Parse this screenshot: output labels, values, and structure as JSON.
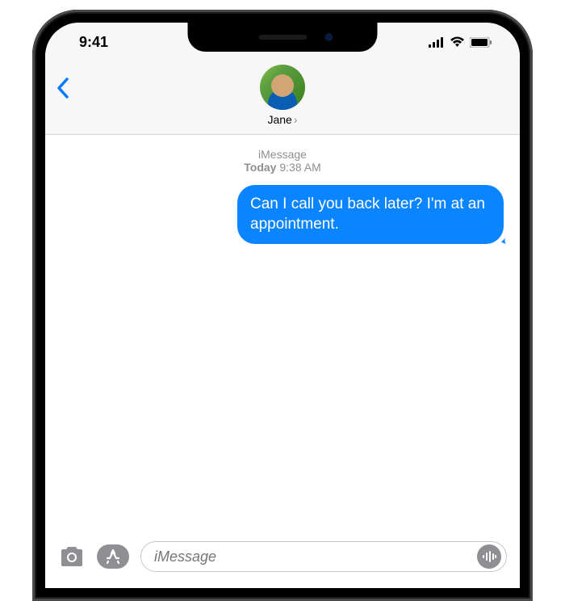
{
  "status_bar": {
    "time": "9:41"
  },
  "header": {
    "contact_name": "Jane",
    "chevron": "›"
  },
  "conversation": {
    "service_label": "iMessage",
    "day_label": "Today",
    "time_label": "9:38 AM",
    "messages": [
      {
        "sender": "me",
        "text": "Can I call you back later? I'm at an appointment."
      }
    ]
  },
  "compose": {
    "placeholder": "iMessage"
  }
}
